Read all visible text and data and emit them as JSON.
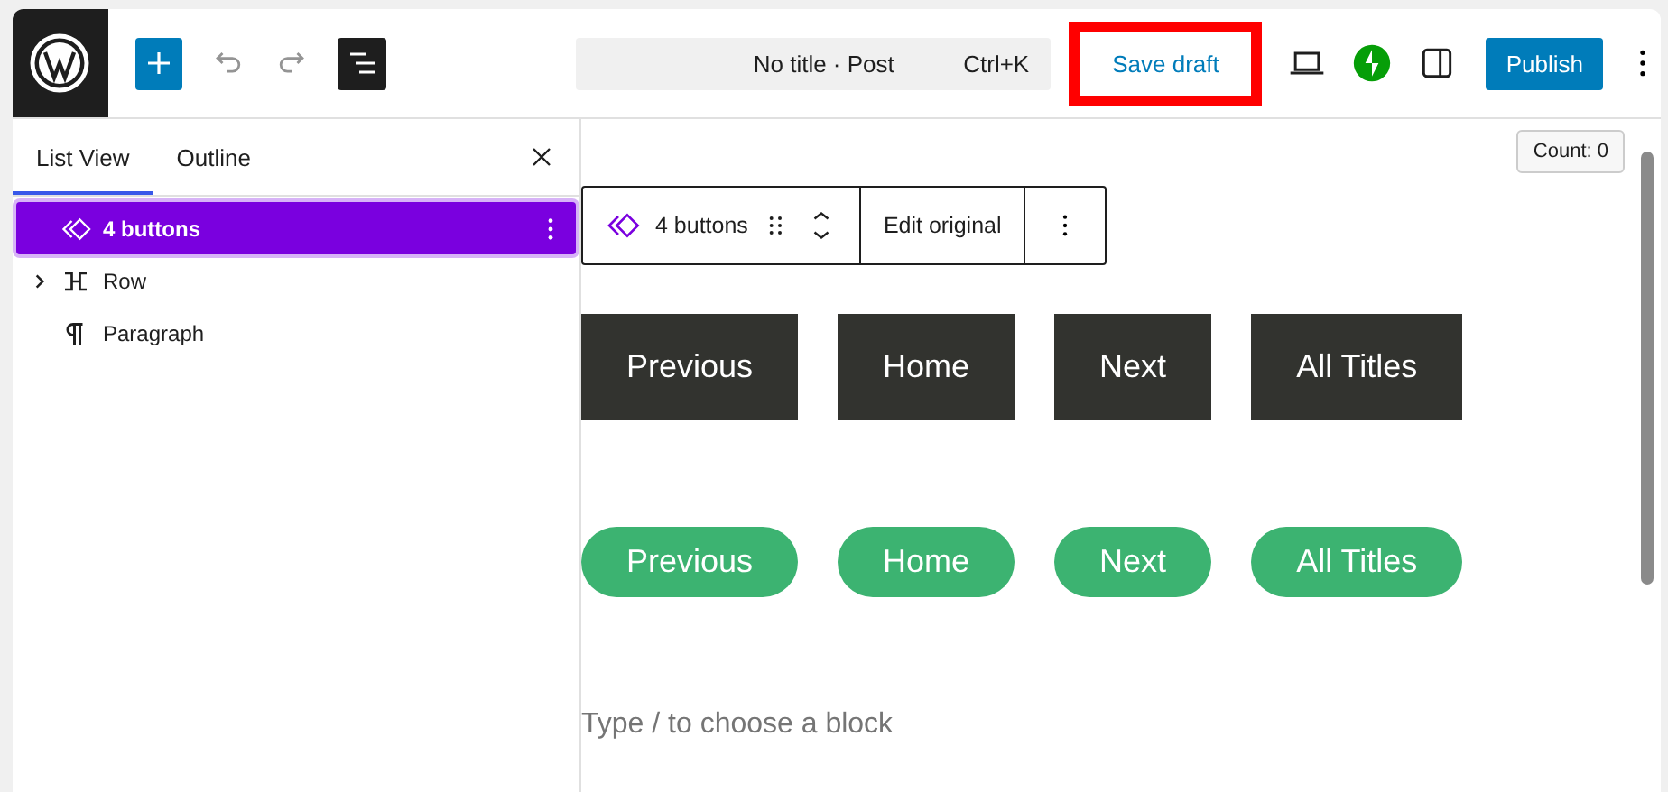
{
  "header": {
    "document_title": "No title · Post",
    "shortcut": "Ctrl+K",
    "save_draft": {
      "label": "Save draft",
      "highlighted": true
    },
    "publish": "Publish"
  },
  "sidebar": {
    "tabs": [
      {
        "label": "List View",
        "selected": true
      },
      {
        "label": "Outline",
        "selected": false
      }
    ],
    "items": [
      {
        "label": "4 buttons",
        "kind": "pattern",
        "selected": true,
        "expandable": false
      },
      {
        "label": "Row",
        "kind": "row",
        "selected": false,
        "expandable": true
      },
      {
        "label": "Paragraph",
        "kind": "paragraph",
        "selected": false,
        "expandable": false
      }
    ]
  },
  "canvas": {
    "count": "Count: 0",
    "block_toolbar": {
      "block": "4 buttons",
      "action": "Edit original"
    },
    "button_rows": [
      {
        "kind": "square",
        "buttons": [
          "Previous",
          "Home",
          "Next",
          "All Titles"
        ]
      },
      {
        "kind": "pill",
        "buttons": [
          "Previous",
          "Home",
          "Next",
          "All Titles"
        ]
      }
    ],
    "paragraph_placeholder": "Type / to choose a block"
  }
}
